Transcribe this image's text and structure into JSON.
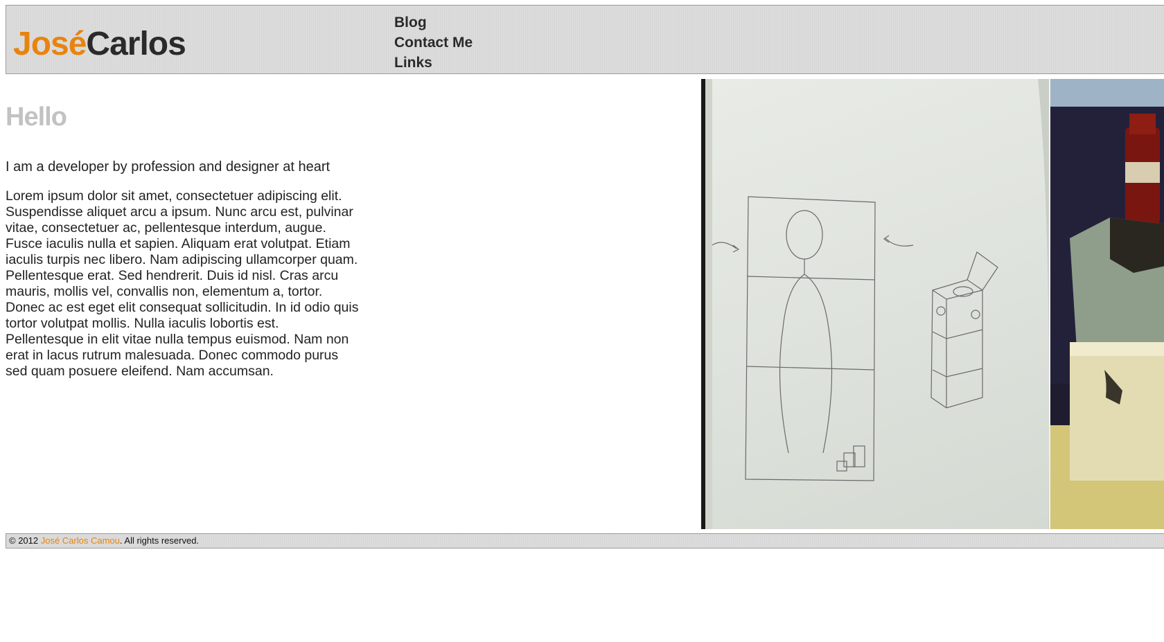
{
  "header": {
    "logo_first": "José",
    "logo_last": "Carlos",
    "nav": [
      {
        "label": "Blog"
      },
      {
        "label": "Contact Me"
      },
      {
        "label": "Links"
      }
    ]
  },
  "main": {
    "heading": "Hello",
    "tagline": "I am a developer by profession and designer at heart",
    "body": "Lorem ipsum dolor sit amet, consectetuer adipiscing elit. Suspendisse aliquet arcu a ipsum. Nunc arcu est, pulvinar vitae, consectetuer ac, pellentesque interdum, augue. Fusce iaculis nulla et sapien. Aliquam erat volutpat. Etiam iaculis turpis nec libero. Nam adipiscing ullamcorper quam. Pellentesque erat. Sed hendrerit. Duis id nisl. Cras arcu mauris, mollis vel, convallis non, elementum a, tortor. Donec ac est eget elit consequat sollicitudin. In id odio quis tortor volutpat mollis. Nulla iaculis lobortis est. Pellentesque in elit vitae nulla tempus euismod. Nam non erat in lacus rutrum malesuada. Donec commodo purus sed quam posuere eleifend. Nam accumsan."
  },
  "gallery": {
    "images": [
      {
        "icon": "sketch-photo"
      },
      {
        "icon": "box-bottle-photo"
      }
    ]
  },
  "footer": {
    "prefix": "© 2012 ",
    "author": "José Carlos Camou",
    "suffix": ". All rights reserved."
  },
  "colors": {
    "accent": "#e8840e",
    "heading_gray": "#c2c2c2",
    "bar_bg": "#dcdcdc"
  }
}
